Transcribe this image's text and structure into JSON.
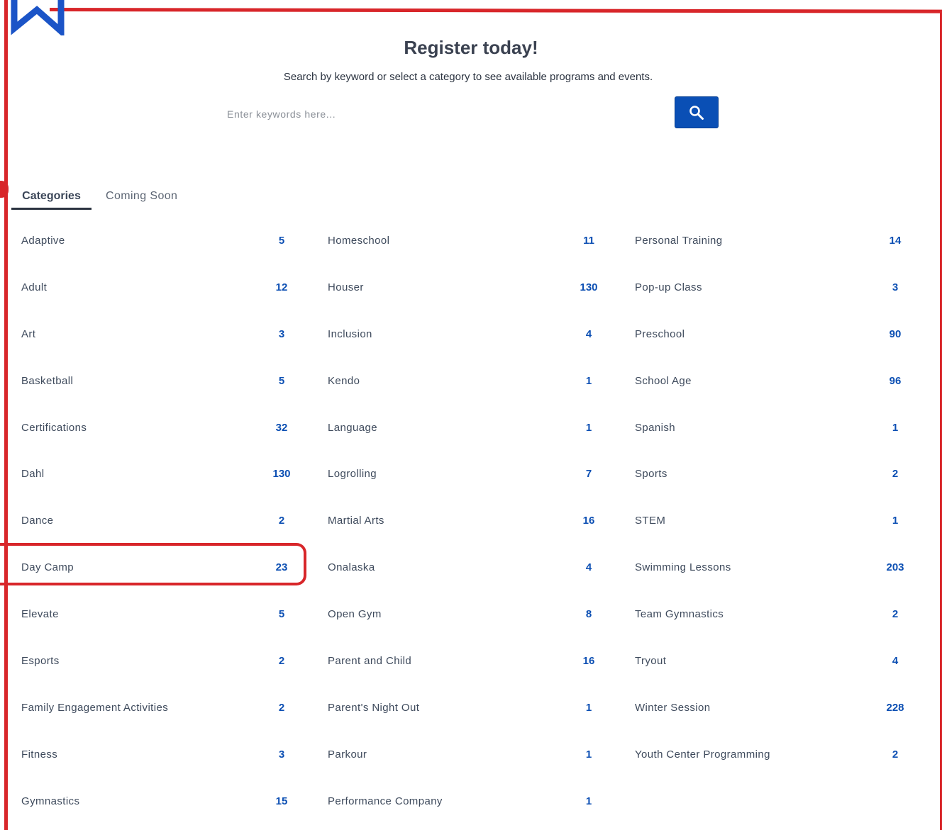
{
  "header": {
    "title": "Register today!",
    "subtitle": "Search by keyword or select a category to see available programs and events."
  },
  "search": {
    "placeholder": "Enter keywords here...",
    "value": ""
  },
  "tabs": [
    {
      "label": "Categories",
      "active": true
    },
    {
      "label": "Coming Soon",
      "active": false
    }
  ],
  "colors": {
    "accent": "#0a4fb5",
    "annotation": "#d8262a",
    "text": "#3e4a5c"
  },
  "icons": {
    "search_button": "search-icon",
    "brand": "logo-icon"
  },
  "highlighted_category": "Day Camp",
  "categories": {
    "col1": [
      {
        "name": "Adaptive",
        "count": "5"
      },
      {
        "name": "Adult",
        "count": "12"
      },
      {
        "name": "Art",
        "count": "3"
      },
      {
        "name": "Basketball",
        "count": "5"
      },
      {
        "name": "Certifications",
        "count": "32"
      },
      {
        "name": "Dahl",
        "count": "130"
      },
      {
        "name": "Dance",
        "count": "2"
      },
      {
        "name": "Day Camp",
        "count": "23"
      },
      {
        "name": "Elevate",
        "count": "5"
      },
      {
        "name": "Esports",
        "count": "2"
      },
      {
        "name": "Family Engagement Activities",
        "count": "2"
      },
      {
        "name": "Fitness",
        "count": "3"
      },
      {
        "name": "Gymnastics",
        "count": "15"
      }
    ],
    "col2": [
      {
        "name": "Homeschool",
        "count": "11"
      },
      {
        "name": "Houser",
        "count": "130"
      },
      {
        "name": "Inclusion",
        "count": "4"
      },
      {
        "name": "Kendo",
        "count": "1"
      },
      {
        "name": "Language",
        "count": "1"
      },
      {
        "name": "Logrolling",
        "count": "7"
      },
      {
        "name": "Martial Arts",
        "count": "16"
      },
      {
        "name": "Onalaska",
        "count": "4"
      },
      {
        "name": "Open Gym",
        "count": "8"
      },
      {
        "name": "Parent and Child",
        "count": "16"
      },
      {
        "name": "Parent's Night Out",
        "count": "1"
      },
      {
        "name": "Parkour",
        "count": "1"
      },
      {
        "name": "Performance Company",
        "count": "1"
      }
    ],
    "col3": [
      {
        "name": "Personal Training",
        "count": "14"
      },
      {
        "name": "Pop-up Class",
        "count": "3"
      },
      {
        "name": "Preschool",
        "count": "90"
      },
      {
        "name": "School Age",
        "count": "96"
      },
      {
        "name": "Spanish",
        "count": "1"
      },
      {
        "name": "Sports",
        "count": "2"
      },
      {
        "name": "STEM",
        "count": "1"
      },
      {
        "name": "Swimming Lessons",
        "count": "203"
      },
      {
        "name": "Team Gymnastics",
        "count": "2"
      },
      {
        "name": "Tryout",
        "count": "4"
      },
      {
        "name": "Winter Session",
        "count": "228"
      },
      {
        "name": "Youth Center Programming",
        "count": "2"
      }
    ]
  }
}
